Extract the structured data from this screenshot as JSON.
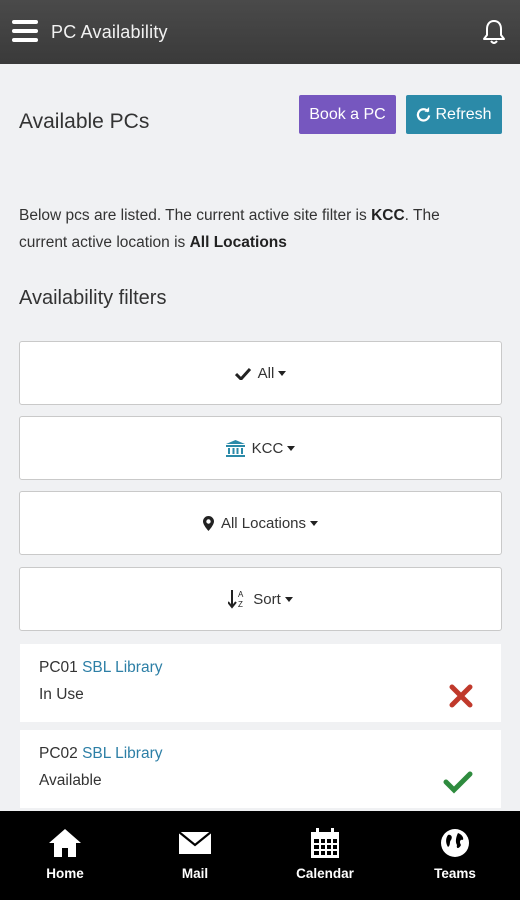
{
  "header": {
    "title": "PC Availability",
    "menu_icon": "hamburger-icon",
    "bell_icon": "bell-icon"
  },
  "main": {
    "title": "Available PCs",
    "book_label": "Book a PC",
    "refresh_label": "Refresh",
    "description": {
      "part1": "Below pcs are listed. The current active site filter is ",
      "site": "KCC",
      "part2": ". The current active location is ",
      "location": "All Locations"
    },
    "filters_title": "Availability filters",
    "filters": [
      {
        "label": "All",
        "icon": "check-icon"
      },
      {
        "label": "KCC",
        "icon": "institution-icon",
        "color": "#2b8aa8"
      },
      {
        "label": "All Locations",
        "icon": "map-marker-icon"
      },
      {
        "label": "Sort",
        "icon": "sort-alpha-icon"
      }
    ],
    "pcs": [
      {
        "name": "PC01",
        "location": "SBL Library",
        "status": "In Use",
        "icon": "x-icon",
        "color": "#c0392b"
      },
      {
        "name": "PC02",
        "location": "SBL Library",
        "status": "Available",
        "icon": "check-icon",
        "color": "#2e8b3e"
      }
    ]
  },
  "nav": [
    {
      "label": "Home",
      "icon": "home-icon"
    },
    {
      "label": "Mail",
      "icon": "mail-icon"
    },
    {
      "label": "Calendar",
      "icon": "calendar-icon"
    },
    {
      "label": "Teams",
      "icon": "globe-icon"
    }
  ],
  "colors": {
    "header_bg": "#3f3f3f",
    "book_btn": "#7657bf",
    "refresh_btn": "#2b8aa8",
    "link": "#2d7fa6",
    "nav_bg": "#000000"
  }
}
